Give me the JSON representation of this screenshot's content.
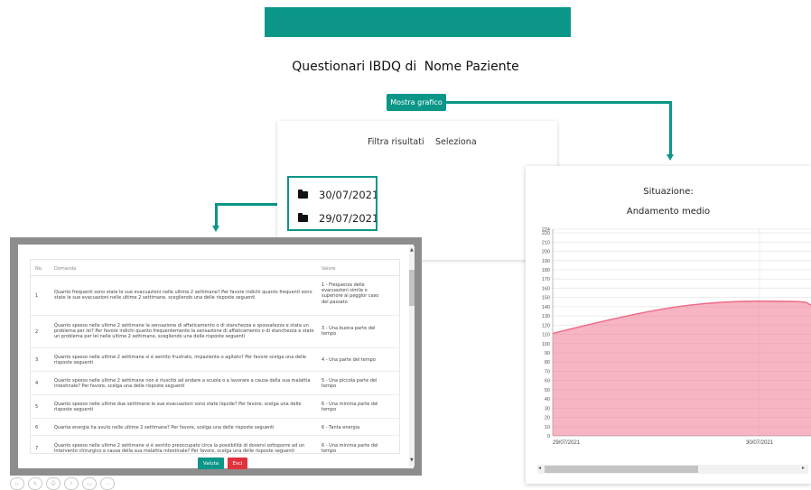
{
  "header": {
    "title_prefix": "Questionari IBDQ di",
    "patient_name": "Nome Paziente",
    "show_chart_button": "Mostra grafico",
    "accent_color": "#0b9688"
  },
  "filter": {
    "filter_label": "Filtra risultati",
    "select_label": "Seleziona",
    "dates": [
      "30/07/2021",
      "29/07/2021"
    ]
  },
  "modal": {
    "columns": [
      "No.",
      "Domanda",
      "Valore"
    ],
    "rows": [
      {
        "no": "1",
        "question": "Quanto frequenti sono state le sue evacuazioni nelle ultime 2 settimane? Per favore indichi quanto frequenti sono state le sue evacuazioni nelle ultime 2 settimane, scegliendo una delle risposte seguenti",
        "value": "1 - Frequenza delle evacuazioni simile o superiore al peggior caso del passato"
      },
      {
        "no": "2",
        "question": "Quanto spesso nelle ultime 2 settimane la sensazione di affaticamento o di stanchezza e spossatezza e stata un problema per lei? Per favore indichi quanto frequentemente la sensazione di affaticamento o di stanchezza e stato un problema per lei nelle ultime 2 settimane, scegliendo una delle risposte seguenti",
        "value": "3 - Una buona parte del tempo"
      },
      {
        "no": "3",
        "question": "Quanto spesso nelle ultime 2 settimane si è sentito frustrato, impaziente o agitato? Per favore scelga una delle risposte seguenti",
        "value": "4 - Una parte del tempo"
      },
      {
        "no": "4",
        "question": "Quanto spesso nelle ultime 2 settimane non è riuscito ad andare a scuola o a lavorare a causa della sua malattia intestinale? Per favore, scelga una delle risposte seguenti",
        "value": "5 - Una piccola parte del tempo"
      },
      {
        "no": "5",
        "question": "Quanto spesso nelle ultime due settimane le sue evacuazioni sono state liquide? Per favore, scelga una delle risposte seguenti",
        "value": "6 - Una minima parte del tempo"
      },
      {
        "no": "6",
        "question": "Quanta energia ha avuto nelle ultime 2 settimane? Per favore, scelga una delle risposte seguenti",
        "value": "6 - Tanta energia"
      },
      {
        "no": "7",
        "question": "Quanto spesso nelle ultime 2 settimane si è sentito preoccupato circa la possibilità di doversi sottoporre ad un intervento chirurgico a causa della sua malattia intestinale? Per favore, scelga una delle risposte seguenti",
        "value": "6 - Una minima parte del tempo"
      }
    ],
    "valuta_button": "Valuta",
    "esci_button": "Esci",
    "valuta_color": "#0b9688",
    "esci_color": "#e0323c"
  },
  "chart_data": {
    "type": "area",
    "title": "Situazione:",
    "subtitle": "Andamento medio",
    "x": [
      "29/07/2021",
      "30/07/2021"
    ],
    "series": [
      {
        "values": [
          111,
          146
        ],
        "color": "#f06a86"
      }
    ],
    "ylim": [
      0,
      224
    ],
    "yticks": [
      0,
      10,
      20,
      30,
      40,
      50,
      60,
      70,
      80,
      90,
      100,
      110,
      120,
      130,
      140,
      150,
      160,
      170,
      180,
      190,
      200,
      210,
      220,
      224
    ],
    "grid": true
  }
}
